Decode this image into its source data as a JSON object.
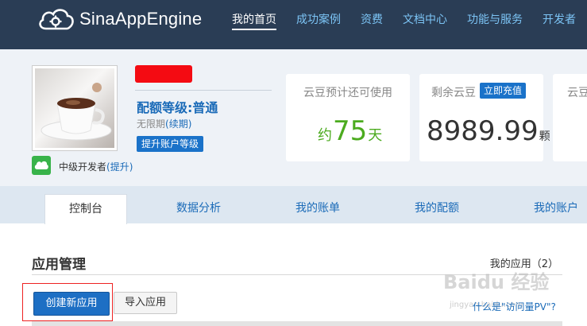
{
  "header": {
    "brand": "SinaAppEngine",
    "nav": [
      "我的首页",
      "成功案例",
      "资费",
      "文档中心",
      "功能与服务",
      "开发者"
    ]
  },
  "profile": {
    "quota_label": "配额等级:普通",
    "expiry_text": "无限期",
    "renew_label": "(续期)",
    "upgrade_button": "提升账户等级",
    "dev_level": "中级开发者",
    "dev_upgrade": "(提升)"
  },
  "cards": {
    "forecast": {
      "title": "云豆预计还可使用",
      "prefix": "约",
      "value": "75",
      "unit": "天"
    },
    "balance": {
      "title": "剩余云豆",
      "recharge_button": "立即充值",
      "value": "8989.99",
      "unit": "颗"
    },
    "third": {
      "title": "云豆"
    }
  },
  "tabs": [
    "控制台",
    "数据分析",
    "我的账单",
    "我的配额",
    "我的账户"
  ],
  "main": {
    "section_title": "应用管理",
    "my_apps": "我的应用（2）",
    "create_button": "创建新应用",
    "import_button": "导入应用",
    "pv_link": "什么是\"访问量PV\"?"
  },
  "watermark": {
    "brand": "Baidu 经验",
    "url": "jingyan.baidu.com"
  },
  "colors": {
    "header_bg": "#2a3d55",
    "accent": "#1a72c9",
    "green": "#4cab1f",
    "highlight": "#e22222"
  }
}
